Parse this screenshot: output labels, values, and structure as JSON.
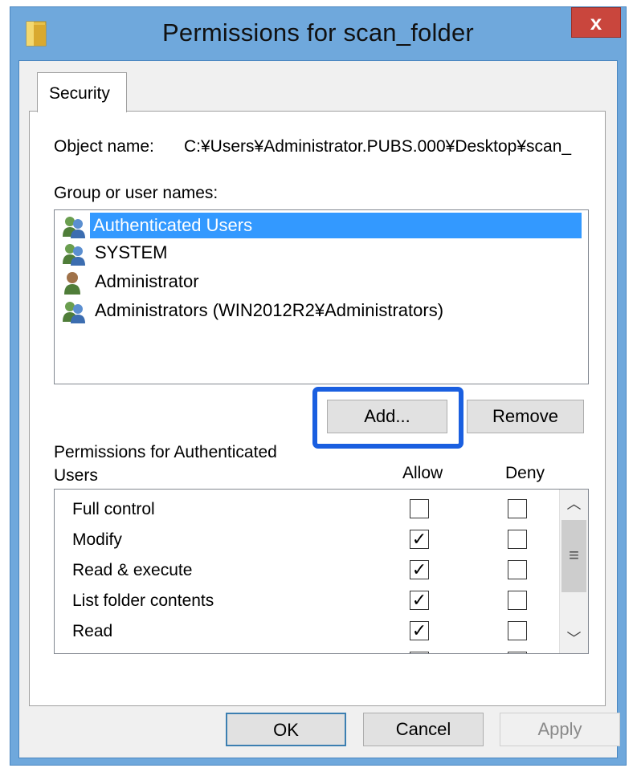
{
  "window": {
    "title": "Permissions for scan_folder",
    "close_label": "x",
    "accent_color": "#6fa8dc",
    "close_color": "#c9463d"
  },
  "tabs": [
    {
      "label": "Security"
    }
  ],
  "security": {
    "object_name_label": "Object name:",
    "object_name_value": "C:¥Users¥Administrator.PUBS.000¥Desktop¥scan_",
    "group_label": "Group or user names:",
    "users": [
      {
        "name": "Authenticated Users",
        "icon": "group-users-icon",
        "selected": true
      },
      {
        "name": "SYSTEM",
        "icon": "group-users-icon",
        "selected": false
      },
      {
        "name": "Administrator",
        "icon": "single-user-icon",
        "selected": false
      },
      {
        "name": "Administrators (WIN2012R2¥Administrators)",
        "icon": "group-users-icon",
        "selected": false
      }
    ],
    "add_button": "Add...",
    "remove_button": "Remove",
    "permissions_label": "Permissions for Authenticated Users",
    "allow_label": "Allow",
    "deny_label": "Deny",
    "permissions": [
      {
        "name": "Full control",
        "allow": false,
        "deny": false
      },
      {
        "name": "Modify",
        "allow": true,
        "deny": false
      },
      {
        "name": "Read & execute",
        "allow": true,
        "deny": false
      },
      {
        "name": "List folder contents",
        "allow": true,
        "deny": false
      },
      {
        "name": "Read",
        "allow": true,
        "deny": false
      }
    ],
    "scroll_up_icon": "chevron-up-icon",
    "scroll_down_icon": "chevron-down-icon",
    "highlight_color": "#1a5fe0"
  },
  "footer": {
    "ok_label": "OK",
    "cancel_label": "Cancel",
    "apply_label": "Apply"
  }
}
